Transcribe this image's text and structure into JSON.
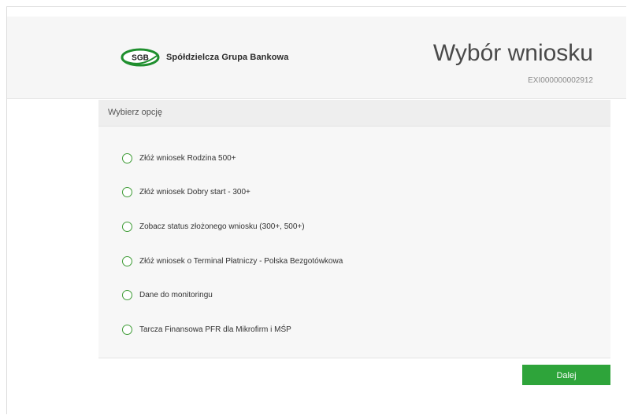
{
  "header": {
    "logo_mark": "SGB",
    "logo_text": "Spółdzielcza Grupa Bankowa",
    "title": "Wybór wniosku",
    "id": "EXI000000002912"
  },
  "panel": {
    "heading": "Wybierz opcję",
    "options": [
      {
        "label": "Złóż wniosek Rodzina 500+"
      },
      {
        "label": "Złóż wniosek Dobry start - 300+"
      },
      {
        "label": "Zobacz status złożonego wniosku (300+, 500+)"
      },
      {
        "label": "Złóż wniosek o Terminal Płatniczy - Polska Bezgotówkowa"
      },
      {
        "label": "Dane do monitoringu"
      },
      {
        "label": "Tarcza Finansowa PFR dla Mikrofirm i MŚP"
      }
    ]
  },
  "actions": {
    "next_label": "Dalej"
  },
  "colors": {
    "accent": "#2ea43a",
    "radio_border": "#3d9b35",
    "header_bg": "#f6f6f6",
    "panel_bg": "#f7f7f7"
  },
  "icons": {
    "logo": "sgb-logo-icon",
    "radio": "radio-unchecked-icon"
  }
}
